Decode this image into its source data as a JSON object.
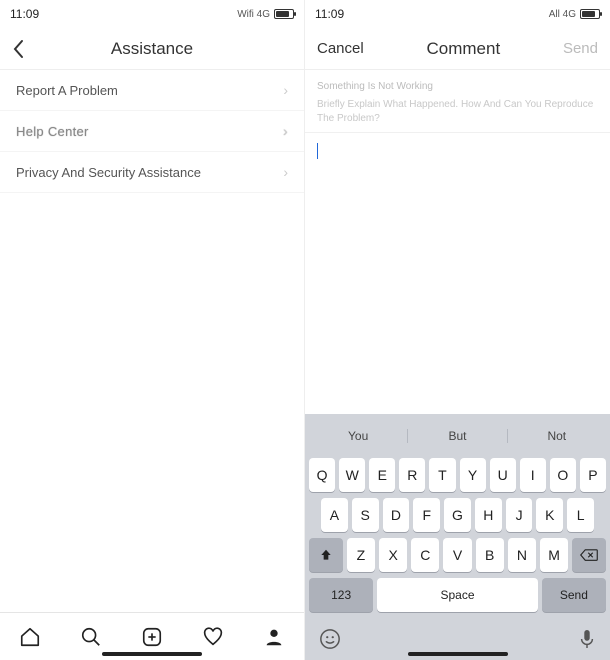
{
  "left_pane": {
    "status": {
      "time": "11:09",
      "network": "Wifi 4G"
    },
    "nav": {
      "title": "Assistance"
    },
    "menu": [
      {
        "label": "Report A Problem"
      },
      {
        "label": "Help Center"
      },
      {
        "label": "Privacy And Security Assistance"
      }
    ]
  },
  "right_pane": {
    "status": {
      "time": "11:09",
      "network": "All 4G"
    },
    "nav": {
      "cancel": "Cancel",
      "title": "Comment",
      "send": "Send"
    },
    "prompt": {
      "line1": "Something Is Not Working",
      "line2": "Briefly Explain What Happened. How And Can You Reproduce The Problem?"
    }
  },
  "keyboard": {
    "suggestions": [
      "You",
      "But",
      "Not"
    ],
    "row1": [
      "Q",
      "W",
      "E",
      "R",
      "T",
      "Y",
      "U",
      "I",
      "O",
      "P"
    ],
    "row2": [
      "A",
      "S",
      "D",
      "F",
      "G",
      "H",
      "J",
      "K",
      "L"
    ],
    "row3": [
      "Z",
      "X",
      "C",
      "V",
      "B",
      "N",
      "M"
    ],
    "numbers": "123",
    "space": "Space",
    "send": "Send"
  }
}
